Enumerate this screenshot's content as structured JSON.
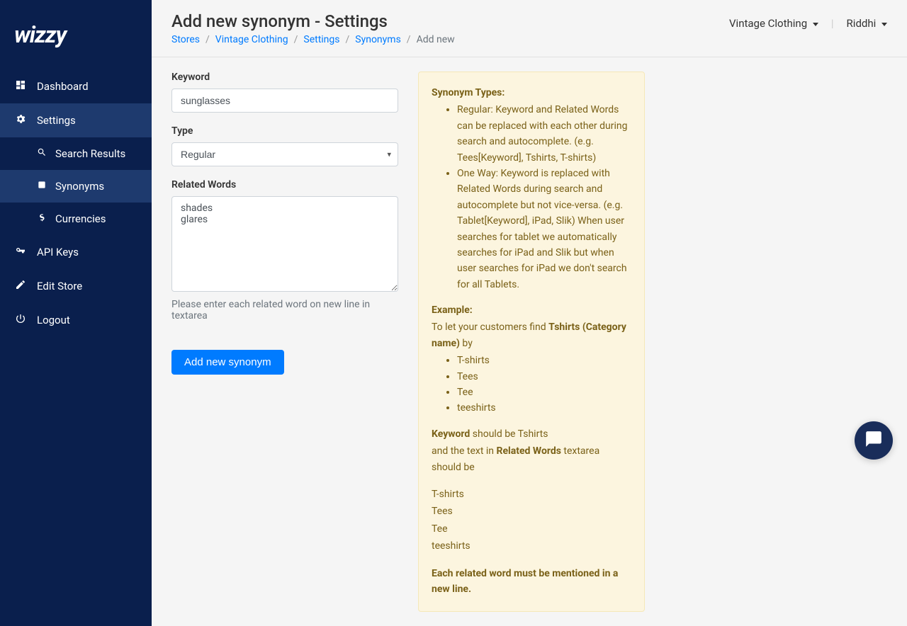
{
  "logo": "wizzy",
  "sidebar": {
    "items": [
      {
        "label": "Dashboard",
        "icon": "dashboard"
      },
      {
        "label": "Settings",
        "icon": "gear"
      },
      {
        "label": "API Keys",
        "icon": "key"
      },
      {
        "label": "Edit Store",
        "icon": "edit"
      },
      {
        "label": "Logout",
        "icon": "power"
      }
    ],
    "subitems": [
      {
        "label": "Search Results",
        "icon": "search"
      },
      {
        "label": "Synonyms",
        "icon": "list"
      },
      {
        "label": "Currencies",
        "icon": "dollar"
      }
    ]
  },
  "header": {
    "title": "Add new synonym - Settings",
    "breadcrumb": {
      "stores": "Stores",
      "store": "Vintage Clothing",
      "settings": "Settings",
      "synonyms": "Synonyms",
      "current": "Add new"
    },
    "store_dropdown": "Vintage Clothing",
    "user_dropdown": "Riddhi"
  },
  "form": {
    "keyword_label": "Keyword",
    "keyword_value": "sunglasses",
    "type_label": "Type",
    "type_value": "Regular",
    "related_label": "Related Words",
    "related_value": "shades\nglares",
    "related_help": "Please enter each related word on new line in textarea",
    "submit_label": "Add new synonym"
  },
  "help": {
    "types_title": "Synonym Types:",
    "regular": "Regular: Keyword and Related Words can be replaced with each other during search and autocomplete. (e.g. Tees[Keyword], Tshirts, T-shirts)",
    "oneway": "One Way: Keyword is replaced with Related Words during search and autocomplete but not vice-versa. (e.g. Tablet[Keyword], iPad, Slik) When user searches for tablet we automatically searches for iPad and Slik but when user searches for iPad we don't search for all Tablets.",
    "example_title": "Example:",
    "example_intro_1": "To let your customers find ",
    "example_intro_bold": "Tshirts (Category name)",
    "example_intro_2": " by",
    "example_items": [
      "T-shirts",
      "Tees",
      "Tee",
      "teeshirts"
    ],
    "keyword_label": "Keyword",
    "keyword_should": " should be Tshirts",
    "textarea_1": "and the text in ",
    "textarea_bold": "Related Words",
    "textarea_2": " textarea should be",
    "textarea_lines": [
      "T-shirts",
      "Tees",
      "Tee",
      "teeshirts"
    ],
    "footer": "Each related word must be mentioned in a new line."
  }
}
